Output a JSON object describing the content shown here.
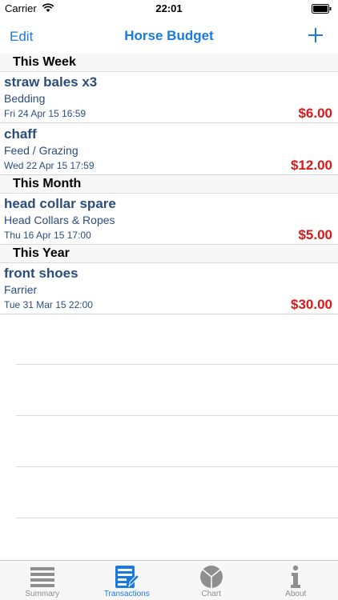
{
  "status": {
    "carrier": "Carrier",
    "time": "22:01"
  },
  "nav": {
    "edit_label": "Edit",
    "title": "Horse Budget"
  },
  "sections": [
    {
      "header": "This Week",
      "rows": [
        {
          "title": "straw bales x3",
          "category": "Bedding",
          "date": "Fri 24 Apr 15 16:59",
          "amount": "$6.00"
        },
        {
          "title": "chaff",
          "category": "Feed / Grazing",
          "date": "Wed 22 Apr 15 17:59",
          "amount": "$12.00"
        }
      ]
    },
    {
      "header": "This Month",
      "rows": [
        {
          "title": "head collar spare",
          "category": "Head Collars & Ropes",
          "date": "Thu 16 Apr 15 17:00",
          "amount": "$5.00"
        }
      ]
    },
    {
      "header": "This Year",
      "rows": [
        {
          "title": "front shoes",
          "category": "Farrier",
          "date": "Tue 31 Mar 15 22:00",
          "amount": "$30.00"
        }
      ]
    }
  ],
  "tabs": [
    {
      "label": "Summary",
      "icon": "list-icon"
    },
    {
      "label": "Transactions",
      "icon": "transactions-icon"
    },
    {
      "label": "Chart",
      "icon": "pie-chart-icon"
    },
    {
      "label": "About",
      "icon": "info-icon"
    }
  ],
  "colors": {
    "accent": "#1a7ae0",
    "text": "#2b4d7e",
    "amount": "#d61a1a"
  }
}
